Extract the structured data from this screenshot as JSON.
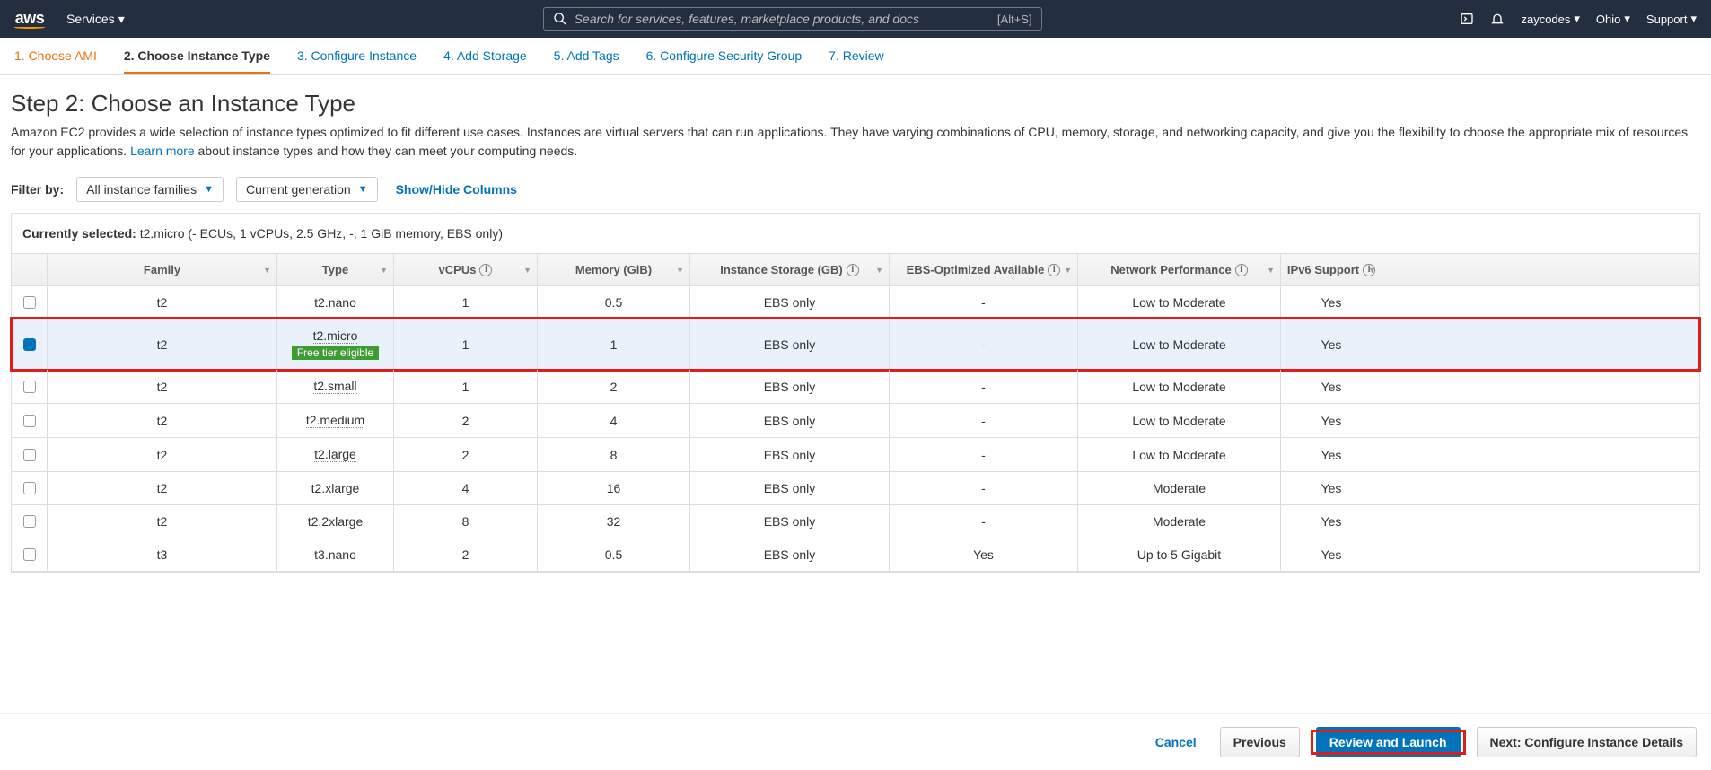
{
  "header": {
    "logo_text": "aws",
    "services": "Services",
    "search_placeholder": "Search for services, features, marketplace products, and docs",
    "search_kbd": "[Alt+S]",
    "user": "zaycodes",
    "region": "Ohio",
    "support": "Support"
  },
  "tabs": [
    {
      "label": "1. Choose AMI",
      "state": "done"
    },
    {
      "label": "2. Choose Instance Type",
      "state": "active"
    },
    {
      "label": "3. Configure Instance",
      "state": ""
    },
    {
      "label": "4. Add Storage",
      "state": ""
    },
    {
      "label": "5. Add Tags",
      "state": ""
    },
    {
      "label": "6. Configure Security Group",
      "state": ""
    },
    {
      "label": "7. Review",
      "state": ""
    }
  ],
  "page": {
    "title": "Step 2: Choose an Instance Type",
    "desc_pre": "Amazon EC2 provides a wide selection of instance types optimized to fit different use cases. Instances are virtual servers that can run applications. They have varying combinations of CPU, memory, storage, and networking capacity, and give you the flexibility to choose the appropriate mix of resources for your applications. ",
    "learn_more": "Learn more",
    "desc_post": " about instance types and how they can meet your computing needs."
  },
  "filter": {
    "label": "Filter by:",
    "families": "All instance families",
    "generation": "Current generation",
    "showhide": "Show/Hide Columns"
  },
  "summary": {
    "prefix": "Currently selected: ",
    "value": "t2.micro (- ECUs, 1 vCPUs, 2.5 GHz, -, 1 GiB memory, EBS only)"
  },
  "columns": {
    "family": "Family",
    "type": "Type",
    "vcpus": "vCPUs",
    "memory": "Memory (GiB)",
    "storage": "Instance Storage (GB)",
    "ebs": "EBS-Optimized Available",
    "network": "Network Performance",
    "ipv6": "IPv6 Support"
  },
  "free_tier_label": "Free tier eligible",
  "rows": [
    {
      "selected": false,
      "family": "t2",
      "type": "t2.nano",
      "dotted": false,
      "free": false,
      "vcpus": "1",
      "memory": "0.5",
      "storage": "EBS only",
      "ebs": "-",
      "network": "Low to Moderate",
      "ipv6": "Yes"
    },
    {
      "selected": true,
      "family": "t2",
      "type": "t2.micro",
      "dotted": true,
      "free": true,
      "vcpus": "1",
      "memory": "1",
      "storage": "EBS only",
      "ebs": "-",
      "network": "Low to Moderate",
      "ipv6": "Yes"
    },
    {
      "selected": false,
      "family": "t2",
      "type": "t2.small",
      "dotted": true,
      "free": false,
      "vcpus": "1",
      "memory": "2",
      "storage": "EBS only",
      "ebs": "-",
      "network": "Low to Moderate",
      "ipv6": "Yes"
    },
    {
      "selected": false,
      "family": "t2",
      "type": "t2.medium",
      "dotted": true,
      "free": false,
      "vcpus": "2",
      "memory": "4",
      "storage": "EBS only",
      "ebs": "-",
      "network": "Low to Moderate",
      "ipv6": "Yes"
    },
    {
      "selected": false,
      "family": "t2",
      "type": "t2.large",
      "dotted": true,
      "free": false,
      "vcpus": "2",
      "memory": "8",
      "storage": "EBS only",
      "ebs": "-",
      "network": "Low to Moderate",
      "ipv6": "Yes"
    },
    {
      "selected": false,
      "family": "t2",
      "type": "t2.xlarge",
      "dotted": false,
      "free": false,
      "vcpus": "4",
      "memory": "16",
      "storage": "EBS only",
      "ebs": "-",
      "network": "Moderate",
      "ipv6": "Yes"
    },
    {
      "selected": false,
      "family": "t2",
      "type": "t2.2xlarge",
      "dotted": false,
      "free": false,
      "vcpus": "8",
      "memory": "32",
      "storage": "EBS only",
      "ebs": "-",
      "network": "Moderate",
      "ipv6": "Yes"
    },
    {
      "selected": false,
      "family": "t3",
      "type": "t3.nano",
      "dotted": false,
      "free": false,
      "vcpus": "2",
      "memory": "0.5",
      "storage": "EBS only",
      "ebs": "Yes",
      "network": "Up to 5 Gigabit",
      "ipv6": "Yes"
    }
  ],
  "footer": {
    "cancel": "Cancel",
    "previous": "Previous",
    "review": "Review and Launch",
    "next": "Next: Configure Instance Details"
  }
}
